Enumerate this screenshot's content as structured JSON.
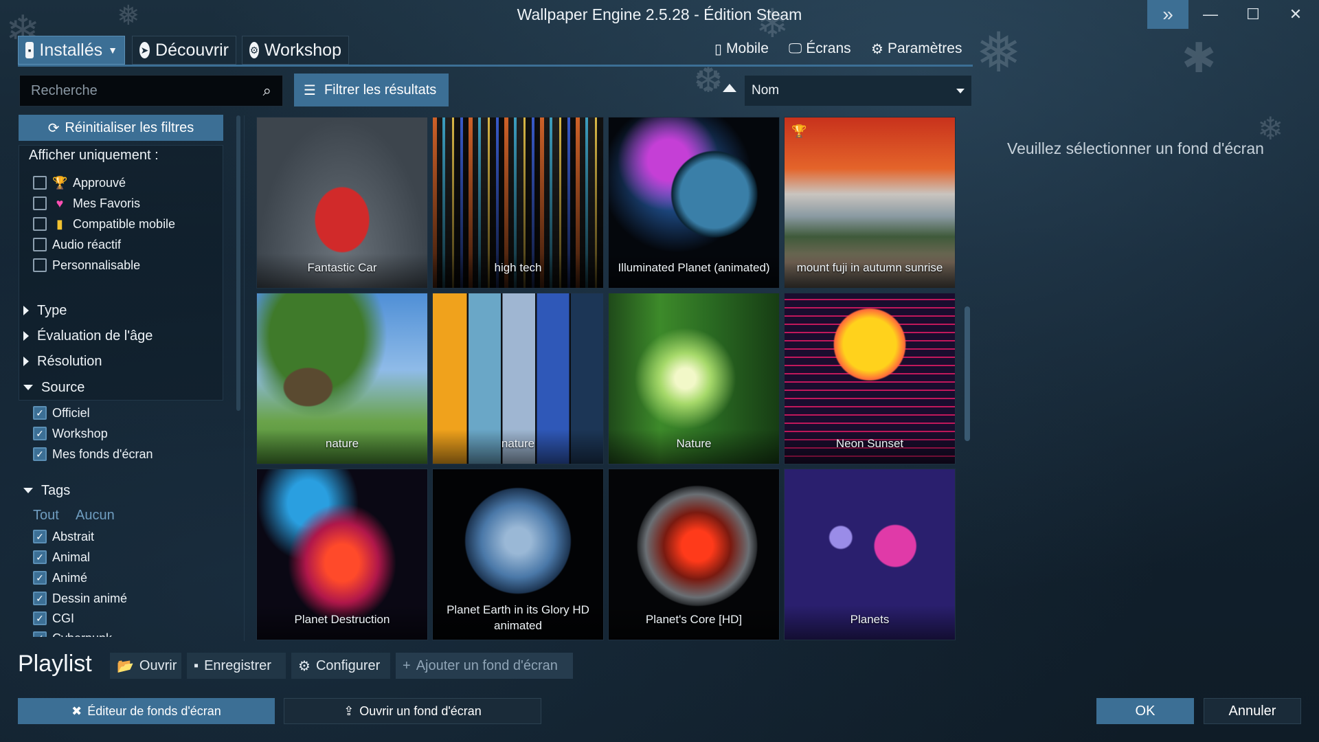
{
  "window": {
    "title": "Wallpaper Engine 2.5.28 - Édition Steam",
    "expand_icon": "double-chevron-right-icon",
    "minimize_icon": "minimize-icon",
    "maximize_icon": "maximize-icon",
    "close_icon": "close-icon"
  },
  "tabs": [
    {
      "label": "Installés",
      "icon": "save-icon",
      "active": true
    },
    {
      "label": "Découvrir",
      "icon": "compass-icon",
      "active": false
    },
    {
      "label": "Workshop",
      "icon": "steam-icon",
      "active": false
    }
  ],
  "top_actions": {
    "mobile": "Mobile",
    "screens": "Écrans",
    "settings": "Paramètres"
  },
  "search": {
    "placeholder": "Recherche"
  },
  "filter_button": "Filtrer les résultats",
  "sort": {
    "value": "Nom",
    "direction": "ascending"
  },
  "sidebar": {
    "reset_label": "Réinitialiser les filtres",
    "show_only_title": "Afficher uniquement :",
    "show_only": [
      {
        "label": "Approuvé",
        "icon": "trophy-icon",
        "checked": false
      },
      {
        "label": "Mes Favoris",
        "icon": "heart-icon",
        "checked": false
      },
      {
        "label": "Compatible mobile",
        "icon": "phone-icon",
        "checked": false
      },
      {
        "label": "Audio réactif",
        "checked": false
      },
      {
        "label": "Personnalisable",
        "checked": false
      }
    ],
    "collapsed_sections": [
      "Type",
      "Évaluation de l'âge",
      "Résolution"
    ],
    "source": {
      "title": "Source",
      "items": [
        {
          "label": "Officiel",
          "checked": true
        },
        {
          "label": "Workshop",
          "checked": true
        },
        {
          "label": "Mes fonds d'écran",
          "checked": true
        }
      ]
    },
    "tags": {
      "title": "Tags",
      "all": "Tout",
      "none": "Aucun",
      "items": [
        {
          "label": "Abstrait",
          "checked": true
        },
        {
          "label": "Animal",
          "checked": true
        },
        {
          "label": "Animé",
          "checked": true
        },
        {
          "label": "Dessin animé",
          "checked": true
        },
        {
          "label": "CGI",
          "checked": true
        },
        {
          "label": "Cyberpunk",
          "checked": true
        }
      ]
    }
  },
  "wallpapers": [
    {
      "title": "Fantastic Car",
      "approved": false
    },
    {
      "title": "high tech",
      "approved": false
    },
    {
      "title": "Illuminated Planet (animated)",
      "approved": false
    },
    {
      "title": "mount fuji in autumn sunrise",
      "approved": true
    },
    {
      "title": "nature",
      "approved": false
    },
    {
      "title": "nature",
      "approved": false
    },
    {
      "title": "Nature",
      "approved": false
    },
    {
      "title": "Neon Sunset",
      "approved": false
    },
    {
      "title": "Planet Destruction",
      "approved": false
    },
    {
      "title": "Planet Earth in its Glory HD animated",
      "approved": false
    },
    {
      "title": "Planet's Core [HD]",
      "approved": false
    },
    {
      "title": "Planets",
      "approved": false
    }
  ],
  "right_panel": {
    "hint": "Veuillez sélectionner un fond d'écran"
  },
  "playlist": {
    "title": "Playlist",
    "open": "Ouvrir",
    "save": "Enregistrer",
    "configure": "Configurer",
    "add": "Ajouter un fond d'écran"
  },
  "bottom": {
    "editor": "Éditeur de fonds d'écran",
    "open_wallpaper": "Ouvrir un fond d'écran",
    "ok": "OK",
    "cancel": "Annuler"
  },
  "colors": {
    "accent": "#3c6f95",
    "background": "#132331",
    "trophy": "#7fd36a",
    "link": "#6f9dc0"
  }
}
